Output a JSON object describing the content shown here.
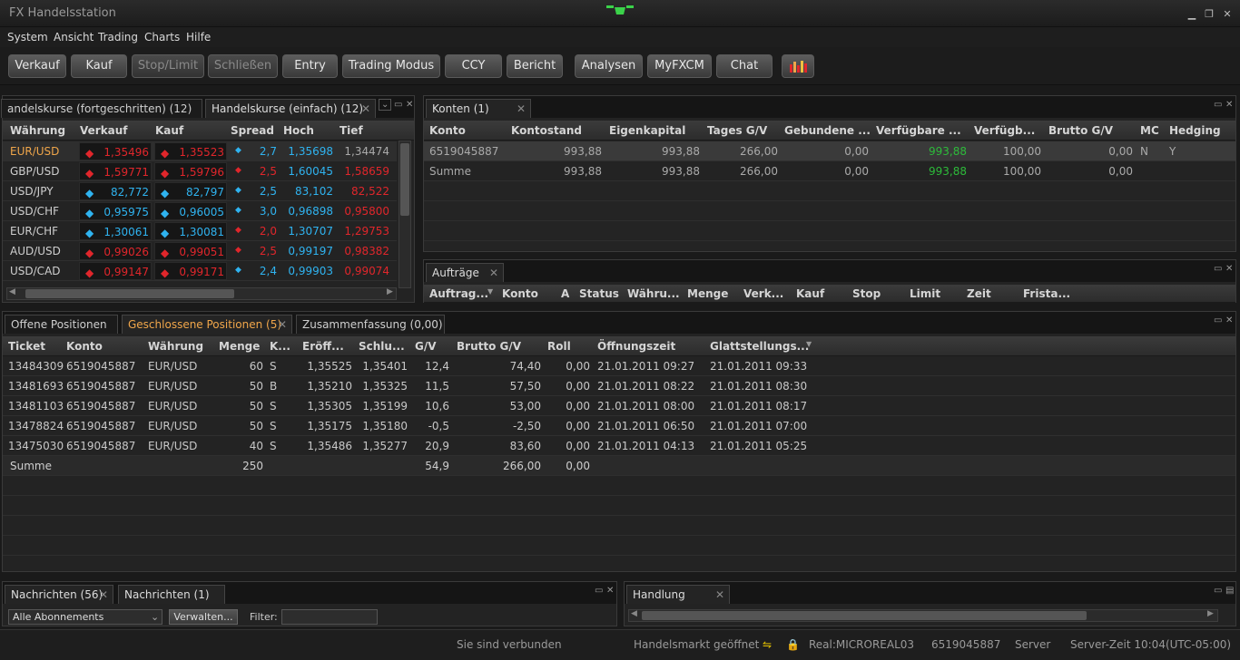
{
  "window": {
    "title": "FX Handelsstation"
  },
  "menu": [
    "System",
    "Ansicht",
    "Trading",
    "Charts",
    "Hilfe"
  ],
  "toolbar": {
    "buttons": [
      "Verkauf",
      "Kauf",
      "Stop/Limit",
      "Schließen",
      "Entry",
      "Trading Modus",
      "CCY",
      "Bericht",
      "Analysen",
      "MyFXCM",
      "Chat"
    ]
  },
  "rates_panel": {
    "tabs": [
      "andelskurse (fortgeschritten)  (12)",
      "Handelskurse (einfach)  (12)"
    ],
    "columns": [
      "Währung",
      "Verkauf",
      "Kauf",
      "Spread",
      "Hoch",
      "Tief"
    ],
    "rows": [
      {
        "pair": "EUR/USD",
        "sell": "1,35496",
        "buy": "1,35523",
        "spread": "2,7",
        "high": "1,35698",
        "low": "1,34474",
        "dir": "down",
        "sdir": "up"
      },
      {
        "pair": "GBP/USD",
        "sell": "1,59771",
        "buy": "1,59796",
        "spread": "2,5",
        "high": "1,60045",
        "low": "1,58659",
        "dir": "down",
        "sdir": "down"
      },
      {
        "pair": "USD/JPY",
        "sell": "82,772",
        "buy": "82,797",
        "spread": "2,5",
        "high": "83,102",
        "low": "82,522",
        "dir": "up",
        "sdir": "up"
      },
      {
        "pair": "USD/CHF",
        "sell": "0,95975",
        "buy": "0,96005",
        "spread": "3,0",
        "high": "0,96898",
        "low": "0,95800",
        "dir": "up",
        "sdir": "up"
      },
      {
        "pair": "EUR/CHF",
        "sell": "1,30061",
        "buy": "1,30081",
        "spread": "2,0",
        "high": "1,30707",
        "low": "1,29753",
        "dir": "up",
        "sdir": "down"
      },
      {
        "pair": "AUD/USD",
        "sell": "0,99026",
        "buy": "0,99051",
        "spread": "2,5",
        "high": "0,99197",
        "low": "0,98382",
        "dir": "down",
        "sdir": "down"
      },
      {
        "pair": "USD/CAD",
        "sell": "0,99147",
        "buy": "0,99171",
        "spread": "2,4",
        "high": "0,99903",
        "low": "0,99074",
        "dir": "down",
        "sdir": "up"
      }
    ]
  },
  "accounts_panel": {
    "tab": "Konten (1)",
    "columns": [
      "Konto",
      "Kontostand",
      "Eigenkapital",
      "Tages G/V",
      "Gebundene ...",
      "Verfügbare ...",
      "Verfügb...",
      "Brutto G/V",
      "MC",
      "Hedging"
    ],
    "rows": [
      [
        "6519045887",
        "993,88",
        "993,88",
        "266,00",
        "0,00",
        "993,88",
        "100,00",
        "0,00",
        "N",
        "Y"
      ],
      [
        "Summe",
        "993,88",
        "993,88",
        "266,00",
        "0,00",
        "993,88",
        "100,00",
        "0,00",
        "",
        ""
      ]
    ]
  },
  "orders_panel": {
    "tab": "Aufträge",
    "columns": [
      "Auftrag...",
      "Konto",
      "A",
      "Status",
      "Währu...",
      "Menge",
      "Verk...",
      "Kauf",
      "Stop",
      "Limit",
      "Zeit",
      "Frista..."
    ]
  },
  "positions_panel": {
    "tabs": [
      "Offene Positionen",
      "Geschlossene Positionen (5)",
      "Zusammenfassung (0,00)"
    ],
    "columns": [
      "Ticket",
      "Konto",
      "Währung",
      "Menge",
      "K...",
      "Eröff...",
      "Schlu...",
      "G/V",
      "Brutto G/V",
      "Roll",
      "Öffnungszeit",
      "Glattstellungs..."
    ],
    "rows": [
      [
        "13484309",
        "6519045887",
        "EUR/USD",
        "60",
        "S",
        "1,35525",
        "1,35401",
        "12,4",
        "74,40",
        "0,00",
        "21.01.2011 09:27",
        "21.01.2011 09:33"
      ],
      [
        "13481693",
        "6519045887",
        "EUR/USD",
        "50",
        "B",
        "1,35210",
        "1,35325",
        "11,5",
        "57,50",
        "0,00",
        "21.01.2011 08:22",
        "21.01.2011 08:30"
      ],
      [
        "13481103",
        "6519045887",
        "EUR/USD",
        "50",
        "S",
        "1,35305",
        "1,35199",
        "10,6",
        "53,00",
        "0,00",
        "21.01.2011 08:00",
        "21.01.2011 08:17"
      ],
      [
        "13478824",
        "6519045887",
        "EUR/USD",
        "50",
        "S",
        "1,35175",
        "1,35180",
        "-0,5",
        "-2,50",
        "0,00",
        "21.01.2011 06:50",
        "21.01.2011 07:00"
      ],
      [
        "13475030",
        "6519045887",
        "EUR/USD",
        "40",
        "S",
        "1,35486",
        "1,35277",
        "20,9",
        "83,60",
        "0,00",
        "21.01.2011 04:13",
        "21.01.2011 05:25"
      ]
    ],
    "summary": {
      "label": "Summe",
      "menge": "250",
      "gv": "54,9",
      "brutto": "266,00",
      "roll": "0,00"
    }
  },
  "news_panel": {
    "tabs": [
      "Nachrichten (56)",
      "Nachrichten  (1)"
    ],
    "select": "Alle Abonnements",
    "manage": "Verwalten...",
    "filter_label": "Filter:"
  },
  "handling_panel": {
    "tab": "Handlung"
  },
  "status": {
    "connected": "Sie sind verbunden",
    "market": "Handelsmarkt geöffnet",
    "account_type": "Real:MICROREAL03",
    "account": "6519045887",
    "server": "Server",
    "time": "Server-Zeit 10:04(UTC-05:00)"
  },
  "colors": {
    "sell": "#e0262b",
    "buy": "#2fb3f0",
    "active_tab": "#f0a64a",
    "positive": "#2dba3a"
  }
}
